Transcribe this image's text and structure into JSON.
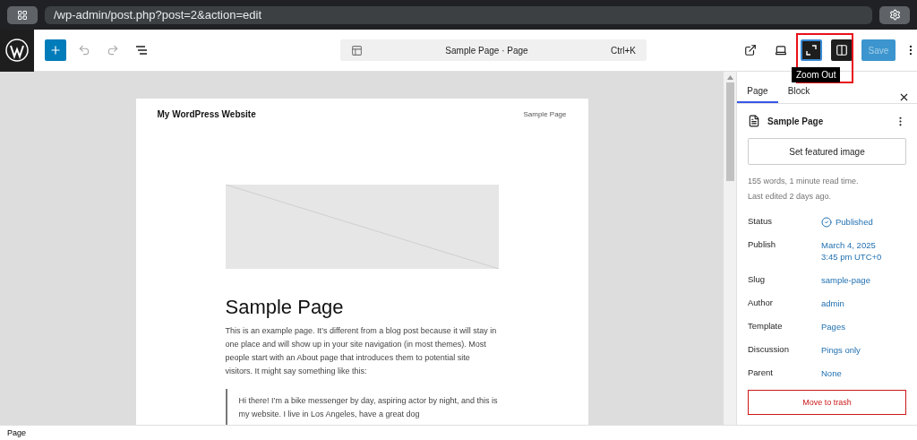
{
  "browser": {
    "url": "/wp-admin/post.php?post=2&action=edit"
  },
  "toolbar": {
    "command": {
      "title": "Sample Page · Page",
      "shortcut": "Ctrl+K"
    },
    "zoom_out": {
      "pressed": true,
      "tooltip": "Zoom Out",
      "highlighted": true
    },
    "save": {
      "label": "Save",
      "disabled": true
    }
  },
  "canvas": {
    "site_title": "My WordPress Website",
    "nav_item": "Sample Page",
    "heading": "Sample Page",
    "paragraph": "This is an example page. It’s different from a blog post because it will stay in one place and will show up in your site navigation (in most themes). Most people start with an About page that introduces them to potential site visitors. It might say something like this:",
    "quote": "Hi there! I’m a bike messenger by day, aspiring actor by night, and this is my website. I live in Los Angeles, have a great dog"
  },
  "sidebar": {
    "tabs": [
      {
        "label": "Page",
        "selected": true
      },
      {
        "label": "Block",
        "selected": false
      }
    ],
    "title": "Sample Page",
    "featured_button": "Set featured image",
    "meta": [
      "155 words, 1 minute read time.",
      "Last edited 2 days ago."
    ],
    "fields": [
      {
        "label": "Status",
        "value": "Published",
        "kind": "status"
      },
      {
        "label": "Publish",
        "value": "March 4, 2025\n3:45 pm UTC+0",
        "kind": "link"
      },
      {
        "label": "Slug",
        "value": "sample-page",
        "kind": "link"
      },
      {
        "label": "Author",
        "value": "admin",
        "kind": "link"
      },
      {
        "label": "Template",
        "value": "Pages",
        "kind": "link"
      },
      {
        "label": "Discussion",
        "value": "Pings only",
        "kind": "link"
      },
      {
        "label": "Parent",
        "value": "None",
        "kind": "link"
      }
    ],
    "trash_button": "Move to trash"
  },
  "status_bar": {
    "breadcrumb": "Page"
  }
}
